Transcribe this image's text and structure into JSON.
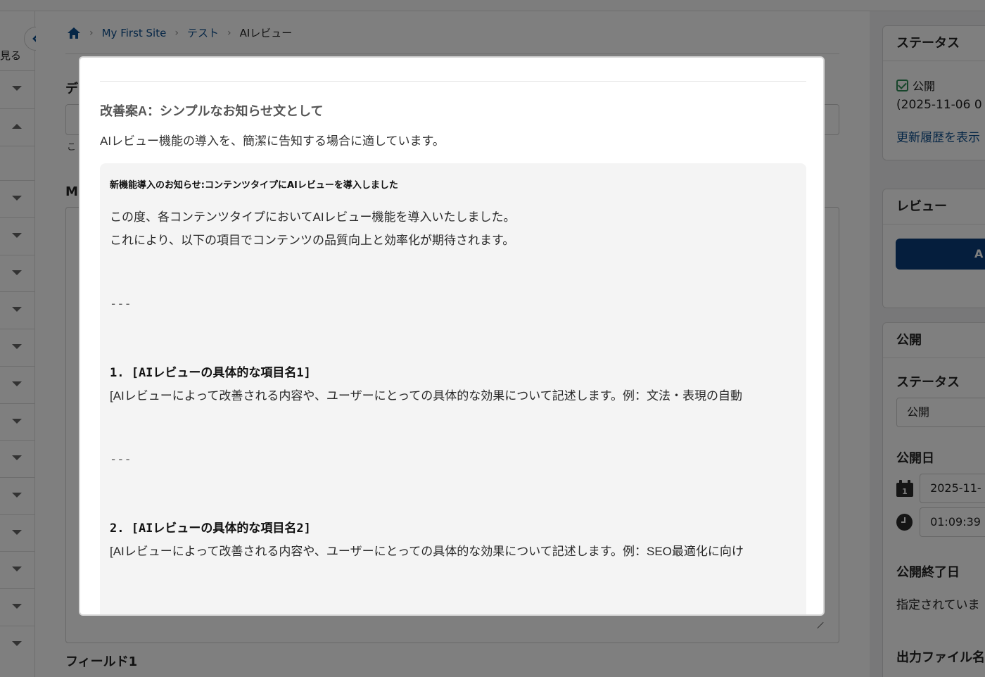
{
  "leftnav": {
    "view_label": "見る"
  },
  "breadcrumb": {
    "items": [
      "My First Site",
      "テスト"
    ],
    "current": "AIレビュー"
  },
  "form": {
    "label_de_partial": "デ",
    "hint_partial": "こ",
    "label_m_partial": "M",
    "field1_label": "フィールド1"
  },
  "sidebar": {
    "status_card": {
      "title": "ステータス",
      "status": "公開",
      "date": "(2025-11-06 0",
      "history_link": "更新履歴を表示"
    },
    "review_card": {
      "title": "レビュー",
      "button_partial": "A"
    },
    "publish_card": {
      "title": "公開",
      "status_label": "ステータス",
      "status_value": "公開",
      "date_label": "公開日",
      "date_value": "2025-11-",
      "time_value": "01:09:39",
      "end_label": "公開終了日",
      "end_value": "指定されていま",
      "filename_label": "出力ファイル名"
    }
  },
  "modal": {
    "proposal_title": "改善案A：シンプルなお知らせ文として",
    "proposal_desc": "AIレビュー機能の導入を、簡潔に告知する場合に適しています。",
    "result": {
      "heading": "新機能導入のお知らせ:コンテンツタイプにAIレビューを導入しました",
      "intro1": "この度、各コンテンツタイプにおいてAIレビュー機能を導入いたしました。",
      "intro2": "これにより、以下の項目でコンテンツの品質向上と効率化が期待されます。",
      "rule": "---",
      "item1_title": "1. [AIレビューの具体的な項目名1]",
      "item1_body": "[AIレビューによって改善される内容や、ユーザーにとっての具体的な効果について記述します。例：文法・表現の自動",
      "item2_title": "2. [AIレビューの具体的な項目名2]",
      "item2_body": "[AIレビューによって改善される内容や、ユーザーにとっての具体的な効果について記述します。例：SEO最適化に向け"
    }
  }
}
